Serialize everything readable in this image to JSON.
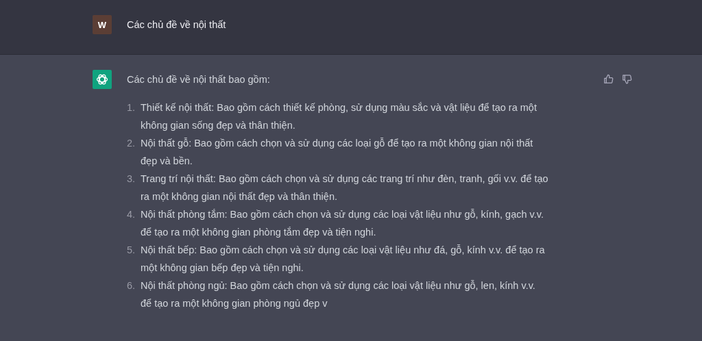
{
  "user_message": {
    "avatar": "W",
    "text": "Các chủ đề về nội thất"
  },
  "assistant_message": {
    "intro": "Các chủ đề về nội thất bao gồm:",
    "items": [
      {
        "number": "1.",
        "text": "Thiết kế nội thất: Bao gồm cách thiết kế phòng, sử dụng màu sắc và vật liệu để tạo ra một không gian sống đẹp và thân thiện."
      },
      {
        "number": "2.",
        "text": "Nội thất gỗ: Bao gồm cách chọn và sử dụng các loại gỗ để tạo ra một không gian nội thất đẹp và bền."
      },
      {
        "number": "3.",
        "text": "Trang trí nội thất: Bao gồm cách chọn và sử dụng các trang trí như đèn, tranh, gối v.v. để tạo ra một không gian nội thất đẹp và thân thiện."
      },
      {
        "number": "4.",
        "text": "Nội thất phòng tắm: Bao gồm cách chọn và sử dụng các loại vật liệu như gỗ, kính, gạch v.v. để tạo ra một không gian phòng tắm đẹp và tiện nghi."
      },
      {
        "number": "5.",
        "text": "Nội thất bếp: Bao gồm cách chọn và sử dụng các loại vật liệu như đá, gỗ, kính v.v. để tạo ra một không gian bếp đẹp và tiện nghi."
      },
      {
        "number": "6.",
        "text": "Nội thất phòng ngủ: Bao gồm cách chọn và sử dụng các loại vật liệu như gỗ, len, kính v.v. để tạo ra một không gian phòng ngủ đẹp v"
      }
    ]
  }
}
